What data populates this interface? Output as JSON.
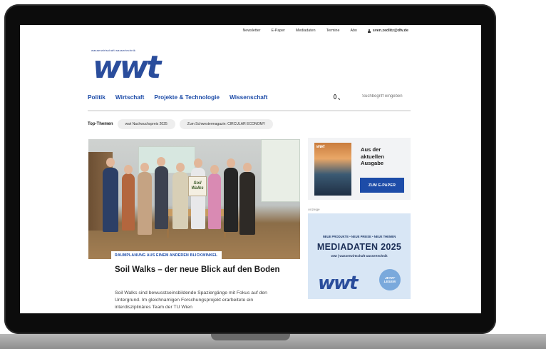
{
  "topnav": {
    "items": [
      "Newsletter",
      "E-Paper",
      "Mediadaten",
      "Termine",
      "Abo"
    ],
    "user_email": "sven.zedlitz@dfv.de",
    "user_icon": "user-icon"
  },
  "logo": {
    "subtitle": "wasserwirtschaft wassertechnik",
    "wordmark": "wwt",
    "color": "#2a4d9c"
  },
  "mainnav": {
    "items": [
      "Politik",
      "Wirtschaft",
      "Projekte & Technologie",
      "Wissenschaft"
    ]
  },
  "search": {
    "placeholder": "Suchbegriff eingeben",
    "icon": "search-icon"
  },
  "top_themes": {
    "label": "Top-Themen",
    "pills": [
      "wwt Nachwuchspreis 2025",
      "Zum Schwestermagazin: CIRCULAR ECONOMY"
    ]
  },
  "article": {
    "image_sign": "Soil Walks",
    "kicker": "RAUMPLANUNG AUS EINEM ANDEREN BLICKWINKEL",
    "headline": "Soil Walks – der neue Blick auf den Boden",
    "teaser": "Soil Walks sind bewusstseinsbildende Spaziergänge mit Fokus auf den Untergrund. Im gleichnamigen Forschungsprojekt erarbeitete ein interdisziplinäres Team der TU Wien"
  },
  "issue": {
    "cover_title": "wwt",
    "text_line1": "Aus der",
    "text_line2": "aktuellen",
    "text_line3": "Ausgabe",
    "button": "ZUM E-PAPER"
  },
  "ad": {
    "label": "Anzeige",
    "top_line": "NEUE PRODUKTE • NEUE PREISE • NEUE THEMEN",
    "title": "MEDIADATEN 2025",
    "subtitle": "wwt | wasserwirtschaft wassertechnik",
    "logo": "wwt",
    "badge_line1": "JETZT",
    "badge_line2": "LESEN!"
  },
  "colors": {
    "brand_blue": "#1d4ca8",
    "ad_background": "#d8e6f5"
  }
}
